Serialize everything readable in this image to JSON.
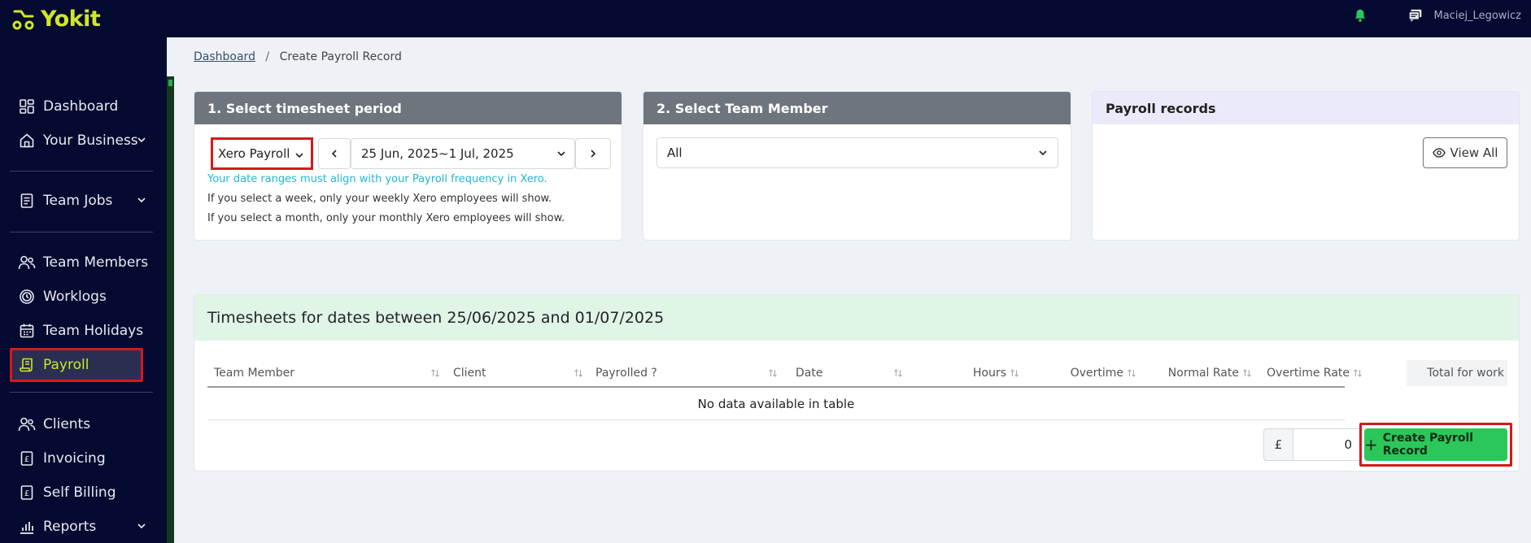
{
  "app": {
    "logo_text": "Yokit",
    "username": "Maciej_Legowicz"
  },
  "sidebar": {
    "items": [
      {
        "label": "Dashboard"
      },
      {
        "label": "Your Business"
      },
      {
        "label": "Team Jobs"
      },
      {
        "label": "Team Members"
      },
      {
        "label": "Worklogs"
      },
      {
        "label": "Team Holidays"
      },
      {
        "label": "Payroll"
      },
      {
        "label": "Clients"
      },
      {
        "label": "Invoicing"
      },
      {
        "label": "Self Billing"
      },
      {
        "label": "Reports"
      }
    ]
  },
  "breadcrumb": {
    "root": "Dashboard",
    "current": "Create Payroll Record"
  },
  "period_card": {
    "title": "1. Select timesheet period",
    "provider": "Xero Payroll",
    "date_range": "25 Jun, 2025~1 Jul, 2025",
    "note_info": "Your date ranges must align with your Payroll frequency in Xero.",
    "note_week": "If you select a week, only your weekly Xero employees will show.",
    "note_month": "If you select a month, only your monthly Xero employees will show."
  },
  "member_card": {
    "title": "2. Select Team Member",
    "selected": "All"
  },
  "records_card": {
    "title": "Payroll records",
    "view_all_label": "View All"
  },
  "timesheets": {
    "title": "Timesheets for dates between 25/06/2025 and 01/07/2025",
    "columns": [
      "Team Member",
      "Client",
      "Payrolled ?",
      "Date",
      "Hours",
      "Overtime",
      "Normal Rate",
      "Overtime Rate",
      "Total for work"
    ],
    "empty_text": "No data available in table",
    "currency": "£",
    "total": "0",
    "create_label": "Create Payroll Record"
  },
  "colors": {
    "sidebar_bg": "#050a30",
    "brand": "#cfe628",
    "accent_green": "#2bc75a",
    "highlight_red": "#d21a1a"
  }
}
